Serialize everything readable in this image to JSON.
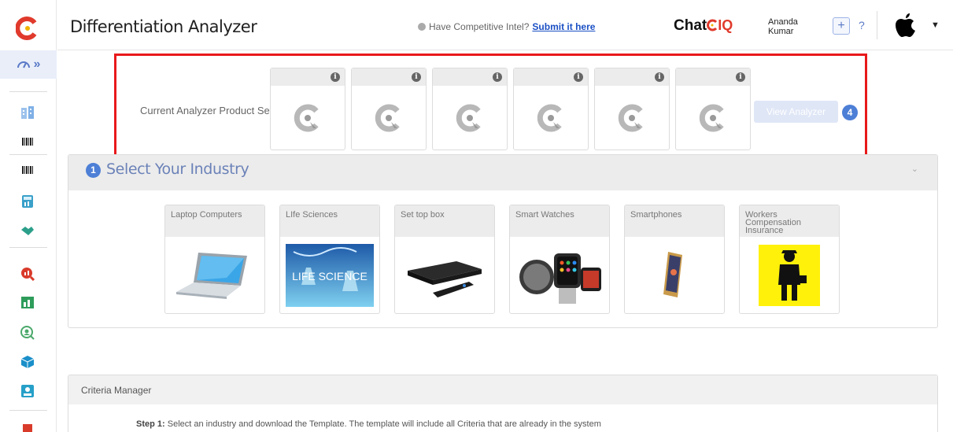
{
  "app": {
    "logo_icon": "chatiq-logo-icon"
  },
  "sidebar": {
    "expand_label": "»",
    "items": [
      {
        "icon": "building-icon",
        "color": "#8fb8e8"
      },
      {
        "icon": "barcode-icon",
        "color": "#222222"
      },
      {
        "icon": "barcode-icon",
        "color": "#222222"
      },
      {
        "icon": "calculator-icon",
        "color": "#3aa0c9"
      },
      {
        "icon": "handshake-icon",
        "color": "#2c9f8a"
      },
      {
        "icon": "search-chart-icon",
        "color": "#d93b2b"
      },
      {
        "icon": "chart-icon",
        "color": "#2e9c5a"
      },
      {
        "icon": "search-user-icon",
        "color": "#4aa86a"
      },
      {
        "icon": "box-icon",
        "color": "#1a8fc9"
      },
      {
        "icon": "profile-card-icon",
        "color": "#26a0c8"
      }
    ]
  },
  "header": {
    "title": "Differentiation Analyzer",
    "intel_prompt": "Have Competitive Intel?",
    "intel_link": "Submit it here",
    "brand_chat": "Chat",
    "brand_iq": "IQ",
    "user_first": "Ananda",
    "user_last": "Kumar",
    "plus_label": "+",
    "help_label": "?",
    "caret_label": "▼"
  },
  "product_set": {
    "label": "Current Analyzer Product Set",
    "slots": [
      {
        "info": "i"
      },
      {
        "info": "i"
      },
      {
        "info": "i"
      },
      {
        "info": "i"
      },
      {
        "info": "i"
      },
      {
        "info": "i"
      }
    ],
    "view_button": "View Analyzer",
    "count": "4"
  },
  "industry": {
    "step": "1",
    "title": "Select Your Industry",
    "chevron": "⌄",
    "cards": [
      {
        "label": "Laptop Computers",
        "image": "laptop-image"
      },
      {
        "label": "LIfe Sciences",
        "image": "life-sciences-image"
      },
      {
        "label": "Set top box",
        "image": "set-top-box-image"
      },
      {
        "label": "Smart Watches",
        "image": "smart-watches-image"
      },
      {
        "label": "Smartphones",
        "image": "smartphone-image"
      },
      {
        "label": "Workers Compensation Insurance",
        "image": "worker-image"
      }
    ]
  },
  "criteria": {
    "title": "Criteria Manager",
    "step1_prefix": "Step 1:",
    "step1_text": " Select an industry and download the Template. The template will include all Criteria that are already in the system"
  }
}
